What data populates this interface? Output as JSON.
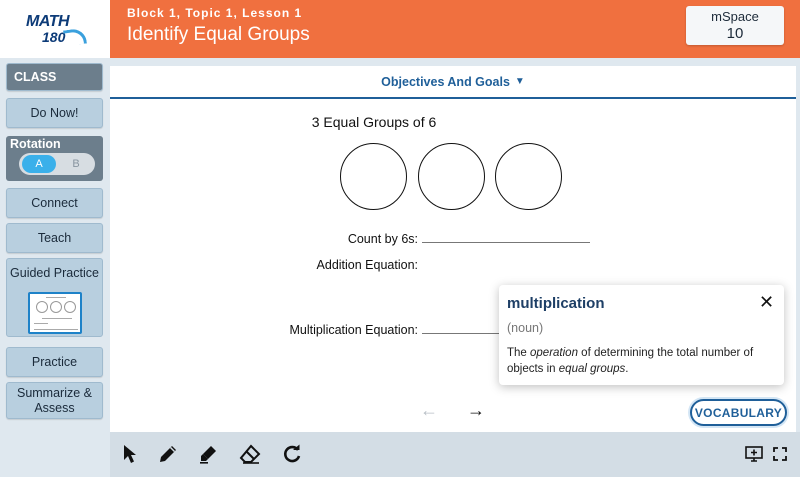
{
  "logo": {
    "line1": "MATH",
    "line2": "180"
  },
  "header": {
    "breadcrumb": "Block 1, Topic 1, Lesson 1",
    "title": "Identify Equal Groups",
    "mspace_label": "mSpace",
    "mspace_value": "10"
  },
  "sidebar": {
    "class_label": "CLASS",
    "do_now": "Do Now!",
    "rotation_label": "Rotation",
    "rotation_a": "A",
    "rotation_b": "B",
    "connect": "Connect",
    "teach": "Teach",
    "guided_practice": "Guided Practice",
    "practice": "Practice",
    "summarize": "Summarize & Assess"
  },
  "main": {
    "objectives_label": "Objectives And Goals",
    "problem_title": "3 Equal Groups of 6",
    "count_label": "Count by 6s:",
    "addition_label": "Addition Equation:",
    "multiplication_label": "Multiplication Equation:",
    "vocab_button": "VOCABULARY"
  },
  "popup": {
    "word": "multiplication",
    "part_of_speech": "(noun)",
    "def_1": "The ",
    "def_2": "operation",
    "def_3": " of determining the total number of objects in ",
    "def_4": "equal groups",
    "def_5": "."
  },
  "colors": {
    "header_orange": "#f0703f",
    "brand_blue": "#1f5f99",
    "nav_bg": "#b8cfdf",
    "nav_dark": "#6c7e8c",
    "toggle_active": "#3ab0ea"
  },
  "icons": {
    "toolbar": [
      "pointer-icon",
      "pen-icon",
      "highlighter-icon",
      "eraser-icon",
      "redo-icon",
      "present-icon",
      "fullscreen-icon"
    ]
  }
}
